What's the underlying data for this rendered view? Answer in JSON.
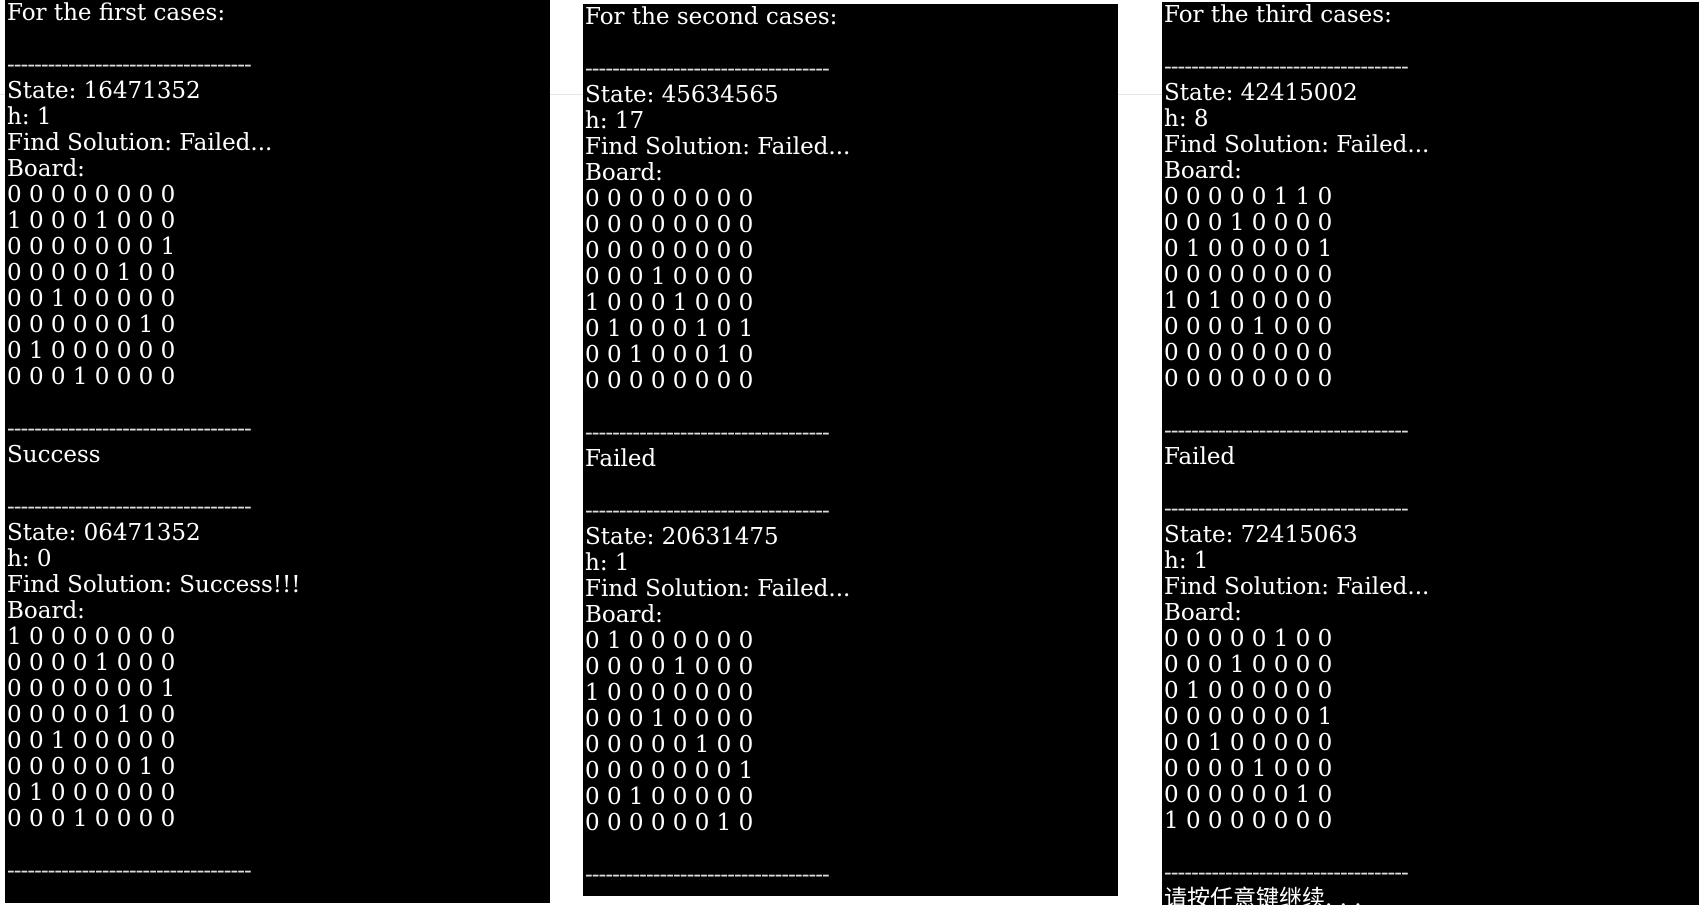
{
  "consoles": [
    {
      "lines": [
        {
          "kind": "text",
          "text": "For the first cases:"
        },
        {
          "kind": "blank"
        },
        {
          "kind": "sep"
        },
        {
          "kind": "text",
          "text": "State: 16471352"
        },
        {
          "kind": "text",
          "text": "h: 1"
        },
        {
          "kind": "text",
          "text": "Find Solution: Failed..."
        },
        {
          "kind": "text",
          "text": "Board:"
        },
        {
          "kind": "board",
          "rows": [
            "0 0 0 0 0 0 0 0",
            "1 0 0 0 1 0 0 0",
            "0 0 0 0 0 0 0 1",
            "0 0 0 0 0 1 0 0",
            "0 0 1 0 0 0 0 0",
            "0 0 0 0 0 0 1 0",
            "0 1 0 0 0 0 0 0",
            "0 0 0 1 0 0 0 0"
          ]
        },
        {
          "kind": "blank"
        },
        {
          "kind": "sep"
        },
        {
          "kind": "text",
          "text": "Success"
        },
        {
          "kind": "blank"
        },
        {
          "kind": "sep"
        },
        {
          "kind": "text",
          "text": "State: 06471352"
        },
        {
          "kind": "text",
          "text": "h: 0"
        },
        {
          "kind": "text",
          "text": "Find Solution: Success!!!"
        },
        {
          "kind": "text",
          "text": "Board:"
        },
        {
          "kind": "board",
          "rows": [
            "1 0 0 0 0 0 0 0",
            "0 0 0 0 1 0 0 0",
            "0 0 0 0 0 0 0 1",
            "0 0 0 0 0 1 0 0",
            "0 0 1 0 0 0 0 0",
            "0 0 0 0 0 0 1 0",
            "0 1 0 0 0 0 0 0",
            "0 0 0 1 0 0 0 0"
          ]
        },
        {
          "kind": "blank"
        },
        {
          "kind": "sep"
        }
      ]
    },
    {
      "lines": [
        {
          "kind": "text",
          "text": "For the second cases:"
        },
        {
          "kind": "blank"
        },
        {
          "kind": "sep"
        },
        {
          "kind": "text",
          "text": "State: 45634565"
        },
        {
          "kind": "text",
          "text": "h: 17"
        },
        {
          "kind": "text",
          "text": "Find Solution: Failed..."
        },
        {
          "kind": "text",
          "text": "Board:"
        },
        {
          "kind": "board",
          "rows": [
            "0 0 0 0 0 0 0 0",
            "0 0 0 0 0 0 0 0",
            "0 0 0 0 0 0 0 0",
            "0 0 0 1 0 0 0 0",
            "1 0 0 0 1 0 0 0",
            "0 1 0 0 0 1 0 1",
            "0 0 1 0 0 0 1 0",
            "0 0 0 0 0 0 0 0"
          ]
        },
        {
          "kind": "blank"
        },
        {
          "kind": "sep"
        },
        {
          "kind": "text",
          "text": "Failed"
        },
        {
          "kind": "blank"
        },
        {
          "kind": "sep"
        },
        {
          "kind": "text",
          "text": "State: 20631475"
        },
        {
          "kind": "text",
          "text": "h: 1"
        },
        {
          "kind": "text",
          "text": "Find Solution: Failed..."
        },
        {
          "kind": "text",
          "text": "Board:"
        },
        {
          "kind": "board",
          "rows": [
            "0 1 0 0 0 0 0 0",
            "0 0 0 0 1 0 0 0",
            "1 0 0 0 0 0 0 0",
            "0 0 0 1 0 0 0 0",
            "0 0 0 0 0 1 0 0",
            "0 0 0 0 0 0 0 1",
            "0 0 1 0 0 0 0 0",
            "0 0 0 0 0 0 1 0"
          ]
        },
        {
          "kind": "blank"
        },
        {
          "kind": "sep"
        }
      ]
    },
    {
      "lines": [
        {
          "kind": "text",
          "text": "For the third cases:"
        },
        {
          "kind": "blank"
        },
        {
          "kind": "sep"
        },
        {
          "kind": "text",
          "text": "State: 42415002"
        },
        {
          "kind": "text",
          "text": "h: 8"
        },
        {
          "kind": "text",
          "text": "Find Solution: Failed..."
        },
        {
          "kind": "text",
          "text": "Board:"
        },
        {
          "kind": "board",
          "rows": [
            "0 0 0 0 0 1 1 0",
            "0 0 0 1 0 0 0 0",
            "0 1 0 0 0 0 0 1",
            "0 0 0 0 0 0 0 0",
            "1 0 1 0 0 0 0 0",
            "0 0 0 0 1 0 0 0",
            "0 0 0 0 0 0 0 0",
            "0 0 0 0 0 0 0 0"
          ]
        },
        {
          "kind": "blank"
        },
        {
          "kind": "sep"
        },
        {
          "kind": "text",
          "text": "Failed"
        },
        {
          "kind": "blank"
        },
        {
          "kind": "sep"
        },
        {
          "kind": "text",
          "text": "State: 72415063"
        },
        {
          "kind": "text",
          "text": "h: 1"
        },
        {
          "kind": "text",
          "text": "Find Solution: Failed..."
        },
        {
          "kind": "text",
          "text": "Board:"
        },
        {
          "kind": "board",
          "rows": [
            "0 0 0 0 0 1 0 0",
            "0 0 0 1 0 0 0 0",
            "0 1 0 0 0 0 0 0",
            "0 0 0 0 0 0 0 1",
            "0 0 1 0 0 0 0 0",
            "0 0 0 0 1 0 0 0",
            "0 0 0 0 0 0 1 0",
            "1 0 0 0 0 0 0 0"
          ]
        },
        {
          "kind": "blank"
        },
        {
          "kind": "sep"
        },
        {
          "kind": "text",
          "text": "请按任意键继续. . ."
        }
      ]
    }
  ],
  "separator": "------------------------------------"
}
